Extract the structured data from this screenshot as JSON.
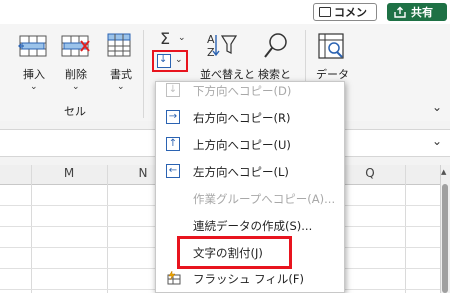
{
  "header": {
    "comment_label": "コメント",
    "share_label": "共有"
  },
  "ribbon": {
    "insert_label": "挿入",
    "delete_label": "削除",
    "format_label": "書式",
    "cells_group_label": "セル",
    "sort_label": "並べ替えと",
    "find_label": "検索と",
    "data_label": "データ",
    "sigma": "Σ"
  },
  "grid": {
    "columns": [
      "M",
      "N",
      "Q"
    ]
  },
  "fill_menu": {
    "items": [
      {
        "label": "下方向へコピー(D)",
        "icon": "arrow-down-icon",
        "glyph": "↓",
        "enabled": false
      },
      {
        "label": "右方向へコピー(R)",
        "icon": "arrow-right-icon",
        "glyph": "→",
        "enabled": true
      },
      {
        "label": "上方向へコピー(U)",
        "icon": "arrow-up-icon",
        "glyph": "↑",
        "enabled": true
      },
      {
        "label": "左方向へコピー(L)",
        "icon": "arrow-left-icon",
        "glyph": "←",
        "enabled": true
      },
      {
        "label": "作業グループへコピー(A)...",
        "icon": "",
        "glyph": "",
        "enabled": false
      },
      {
        "label": "連続データの作成(S)...",
        "icon": "",
        "glyph": "",
        "enabled": true
      },
      {
        "label": "文字の割付(J)",
        "icon": "",
        "glyph": "",
        "enabled": true
      },
      {
        "label": "フラッシュ フィル(F)",
        "icon": "flash-fill-icon",
        "glyph": "",
        "enabled": true
      }
    ]
  },
  "colors": {
    "accent_green": "#1e7145",
    "highlight_red": "#e8141e",
    "icon_blue": "#2b63b2"
  }
}
